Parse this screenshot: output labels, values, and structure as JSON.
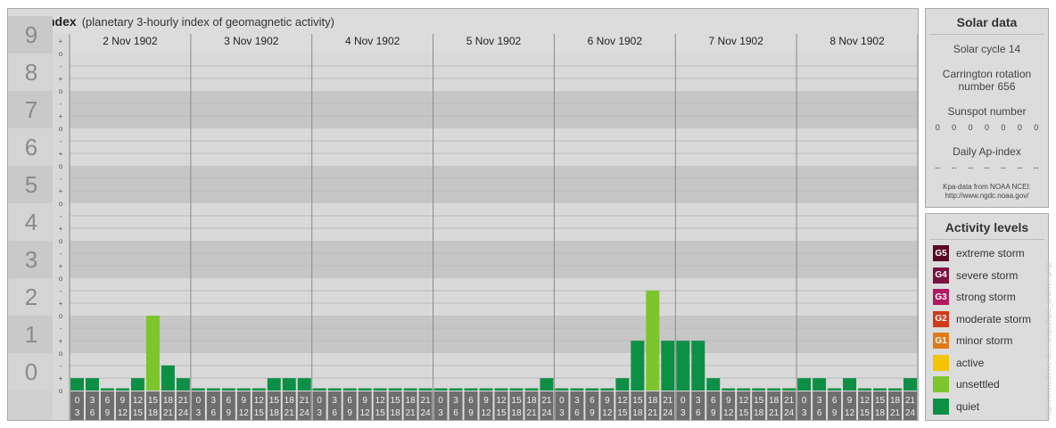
{
  "header": {
    "title": "Kpa-index",
    "subtitle": "(planetary 3-hourly index of geomagnetic activity)"
  },
  "chart_data": {
    "type": "bar",
    "title": "Kpa-index",
    "subtitle": "(planetary 3-hourly index of geomagnetic activity)",
    "ylim": [
      0,
      9
    ],
    "y_ticks": [
      "0",
      "1",
      "2",
      "3",
      "4",
      "5",
      "6",
      "7",
      "8",
      "9"
    ],
    "y_minor_ticks": [
      "+",
      "o",
      "-"
    ],
    "days": [
      "2 Nov 1902",
      "3 Nov 1902",
      "4 Nov 1902",
      "5 Nov 1902",
      "6 Nov 1902",
      "7 Nov 1902",
      "8 Nov 1902"
    ],
    "interval_labels": [
      [
        "0",
        "3"
      ],
      [
        "3",
        "6"
      ],
      [
        "6",
        "9"
      ],
      [
        "9",
        "12"
      ],
      [
        "12",
        "15"
      ],
      [
        "15",
        "18"
      ],
      [
        "18",
        "21"
      ],
      [
        "21",
        "24"
      ]
    ],
    "values": [
      0.33,
      0.33,
      0,
      0,
      0.33,
      2.0,
      0.67,
      0.33,
      0,
      0,
      0,
      0,
      0,
      0.33,
      0.33,
      0.33,
      0,
      0,
      0,
      0,
      0,
      0,
      0,
      0,
      0,
      0,
      0,
      0,
      0,
      0,
      0,
      0.33,
      0,
      0,
      0,
      0,
      0.33,
      1.33,
      2.67,
      1.33,
      1.33,
      1.33,
      0.33,
      0,
      0,
      0,
      0,
      0,
      0.33,
      0.33,
      0,
      0.33,
      0,
      0,
      0,
      0.33
    ],
    "levels": [
      {
        "min": 0,
        "max": 4,
        "color": "#0d8f46",
        "name": "quiet"
      },
      {
        "min": 1.67,
        "max": 4,
        "color": "#7dc52c",
        "name": "unsettled"
      }
    ],
    "grid": true
  },
  "solar": {
    "title": "Solar data",
    "cycle": "Solar cycle 14",
    "carrington_line1": "Carrington rotation",
    "carrington_line2": "number 656",
    "sunspot_label": "Sunspot number",
    "sunspot_values": [
      "0",
      "0",
      "0",
      "0",
      "0",
      "0",
      "0"
    ],
    "ap_label": "Daily Ap-index",
    "ap_values": [
      "--",
      "--",
      "--",
      "--",
      "--",
      "--",
      "--"
    ],
    "credit_line1": "Kpa-data from NOAA NCEI:",
    "credit_line2": "http://www.ngdc.noaa.gov/"
  },
  "activity": {
    "title": "Activity levels",
    "items": [
      {
        "badge": "G5",
        "label": "extreme storm",
        "color": "#5a0a26"
      },
      {
        "badge": "G4",
        "label": "severe storm",
        "color": "#7a1240"
      },
      {
        "badge": "G3",
        "label": "strong storm",
        "color": "#b01a60"
      },
      {
        "badge": "G2",
        "label": "moderate storm",
        "color": "#d03a1a"
      },
      {
        "badge": "G1",
        "label": "minor storm",
        "color": "#e07a1a"
      },
      {
        "badge": "",
        "label": "active",
        "color": "#f5c400"
      },
      {
        "badge": "",
        "label": "unsettled",
        "color": "#7dc52c"
      },
      {
        "badge": "",
        "label": "quiet",
        "color": "#0d8f46"
      }
    ]
  },
  "watermark": "http://www.tiewe.de/eu/kpa/kpa_archive.php"
}
